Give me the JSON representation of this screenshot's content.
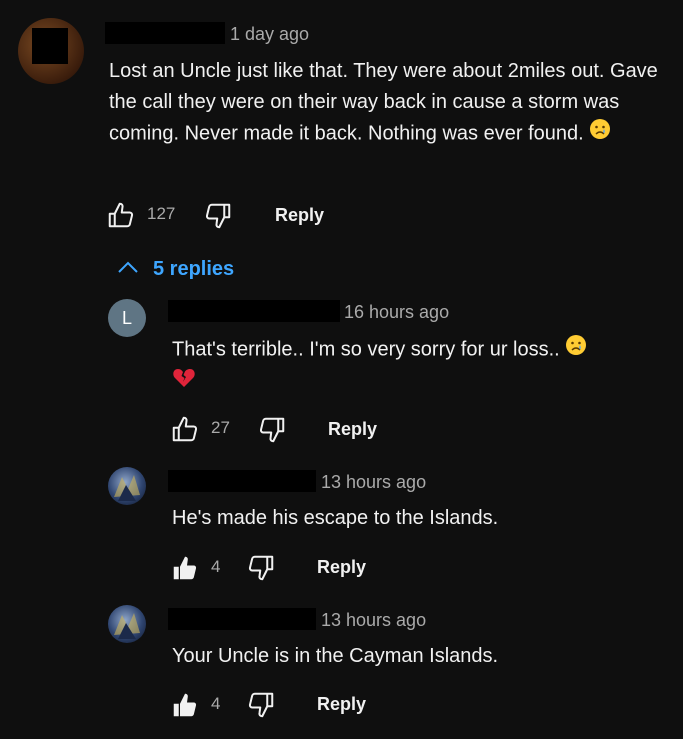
{
  "comment": {
    "time": "1 day ago",
    "text": "Lost an Uncle just like that. They were about 2miles out. Gave the call they were on their way back in cause a storm was coming. Never made it back. Nothing was ever found.",
    "emoji": "cry-emoji",
    "likes": "127",
    "reply_label": "Reply"
  },
  "replies_toggle": {
    "label": "5 replies",
    "icon": "chevron-up-icon",
    "color": "#3ea6ff"
  },
  "replies": [
    {
      "avatar_letter": "L",
      "avatar_color": "#5f7584",
      "time": "16 hours ago",
      "text": "That's terrible.. I'm so very sorry for ur loss..",
      "likes": "27",
      "reply_label": "Reply",
      "liked": false
    },
    {
      "time": "13 hours ago",
      "text": "He's made his escape to the Islands.",
      "likes": "4",
      "reply_label": "Reply",
      "liked": true
    },
    {
      "time": "13 hours ago",
      "text": "Your Uncle is in the Cayman Islands.",
      "likes": "4",
      "reply_label": "Reply",
      "liked": true
    }
  ]
}
